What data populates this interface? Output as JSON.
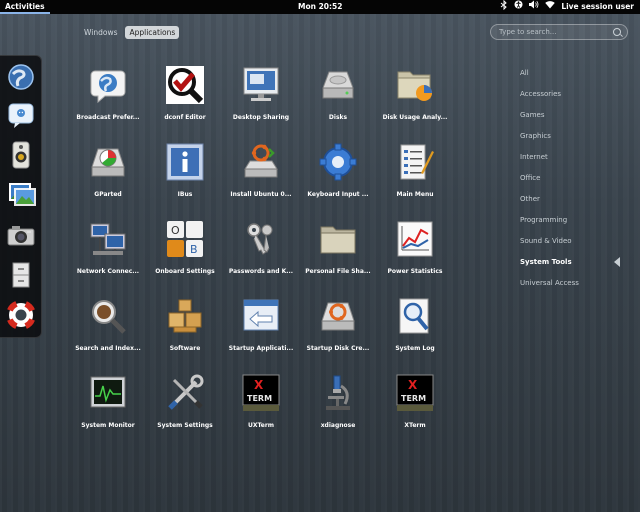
{
  "topbar": {
    "activities": "Activities",
    "clock": "Mon 20:52",
    "user": "Live session user"
  },
  "view_tabs": {
    "windows": "Windows",
    "applications": "Applications"
  },
  "search": {
    "placeholder": "Type to search..."
  },
  "categories": [
    "All",
    "Accessories",
    "Games",
    "Graphics",
    "Internet",
    "Office",
    "Other",
    "Programming",
    "Sound & Video",
    "System Tools",
    "Universal Access"
  ],
  "selected_category": "System Tools",
  "dash": [
    "web-browser-icon",
    "chat-icon",
    "speaker-icon",
    "image-viewer-icon",
    "camera-icon",
    "file-cabinet-icon",
    "help-lifebuoy-icon"
  ],
  "apps": [
    {
      "label": "Broadcast Prefer...",
      "icon": "broadcast-globe-icon"
    },
    {
      "label": "dconf Editor",
      "icon": "dconf-checkmark-icon"
    },
    {
      "label": "Desktop Sharing",
      "icon": "desktop-sharing-icon"
    },
    {
      "label": "Disks",
      "icon": "disk-drive-icon"
    },
    {
      "label": "Disk Usage Analy...",
      "icon": "disk-usage-folder-icon"
    },
    {
      "label": "GParted",
      "icon": "gparted-icon"
    },
    {
      "label": "IBus",
      "icon": "ibus-info-icon"
    },
    {
      "label": "Install Ubuntu 0...",
      "icon": "install-ubuntu-icon"
    },
    {
      "label": "Keyboard Input ...",
      "icon": "keyboard-gear-icon"
    },
    {
      "label": "Main Menu",
      "icon": "main-menu-icon"
    },
    {
      "label": "Network Connec...",
      "icon": "network-computers-icon"
    },
    {
      "label": "Onboard Settings",
      "icon": "onboard-keys-icon"
    },
    {
      "label": "Passwords and K...",
      "icon": "keys-icon"
    },
    {
      "label": "Personal File Sha...",
      "icon": "file-share-folder-icon"
    },
    {
      "label": "Power Statistics",
      "icon": "power-chart-icon"
    },
    {
      "label": "Search and Index...",
      "icon": "search-magnifier-icon"
    },
    {
      "label": "Software",
      "icon": "software-boxes-icon"
    },
    {
      "label": "Startup Applicati...",
      "icon": "startup-apps-icon"
    },
    {
      "label": "Startup Disk Cre...",
      "icon": "startup-disk-icon"
    },
    {
      "label": "System Log",
      "icon": "system-log-icon"
    },
    {
      "label": "System Monitor",
      "icon": "system-monitor-icon"
    },
    {
      "label": "System Settings",
      "icon": "settings-tools-icon"
    },
    {
      "label": "UXTerm",
      "icon": "uxterm-icon"
    },
    {
      "label": "xdiagnose",
      "icon": "microscope-icon"
    },
    {
      "label": "XTerm",
      "icon": "xterm-icon"
    }
  ],
  "icon_text": {
    "xterm_x": "X",
    "xterm_term": "TERM",
    "onboard_o": "O",
    "onboard_b": "B"
  }
}
